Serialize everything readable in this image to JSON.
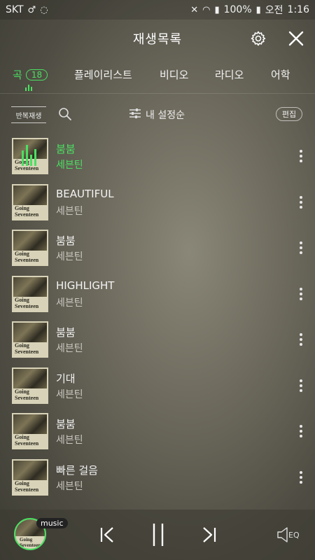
{
  "statusbar": {
    "carrier": "SKT",
    "battery": "100%",
    "ampm": "오전",
    "time": "1:16"
  },
  "header": {
    "title": "재생목록",
    "settings_icon": "gear-icon",
    "close_icon": "close-icon"
  },
  "tabs": [
    {
      "label": "곡",
      "count": "18"
    },
    {
      "label": "플레이리스트"
    },
    {
      "label": "비디오"
    },
    {
      "label": "라디오"
    },
    {
      "label": "어학"
    }
  ],
  "toolbar": {
    "repeat_label": "반복재생",
    "sort_label": "내 설정순",
    "edit_label": "편집"
  },
  "songs": [
    {
      "title": "붐붐",
      "artist": "세븐틴",
      "playing": true
    },
    {
      "title": "BEAUTIFUL",
      "artist": "세븐틴"
    },
    {
      "title": "붐붐",
      "artist": "세븐틴"
    },
    {
      "title": "HIGHLIGHT",
      "artist": "세븐틴"
    },
    {
      "title": "붐붐",
      "artist": "세븐틴"
    },
    {
      "title": "기대",
      "artist": "세븐틴"
    },
    {
      "title": "붐붐",
      "artist": "세븐틴"
    },
    {
      "title": "빠른 걸음",
      "artist": "세븐틴"
    }
  ],
  "album_art_text": [
    "Going",
    "Seventeen"
  ],
  "player": {
    "badge": "music",
    "eq_label": "EQ"
  },
  "colors": {
    "accent": "#4be062"
  }
}
